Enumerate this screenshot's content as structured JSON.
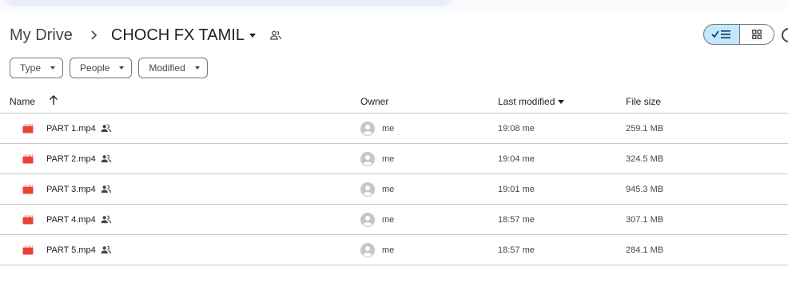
{
  "breadcrumb": {
    "root": "My Drive",
    "current": "CHOCH FX TAMIL"
  },
  "filters": [
    {
      "label": "Type"
    },
    {
      "label": "People"
    },
    {
      "label": "Modified"
    }
  ],
  "columns": {
    "name": "Name",
    "owner": "Owner",
    "last_modified": "Last modified",
    "file_size": "File size"
  },
  "files": [
    {
      "name": "PART 1.mp4",
      "owner": "me",
      "modified": "19:08 me",
      "size": "259.1 MB"
    },
    {
      "name": "PART 2.mp4",
      "owner": "me",
      "modified": "19:04 me",
      "size": "324.5 MB"
    },
    {
      "name": "PART 3.mp4",
      "owner": "me",
      "modified": "19:01 me",
      "size": "945.3 MB"
    },
    {
      "name": "PART 4.mp4",
      "owner": "me",
      "modified": "18:57 me",
      "size": "307.1 MB"
    },
    {
      "name": "PART 5.mp4",
      "owner": "me",
      "modified": "18:57 me",
      "size": "284.1 MB"
    }
  ],
  "colors": {
    "accent": "#c2e7ff",
    "video_icon": "#ea4335",
    "divider": "#c4c7c5"
  },
  "icons": {
    "video": "video-file-icon",
    "shared": "shared-people-icon",
    "avatar": "default-avatar-icon",
    "sort": "arrow-up-icon"
  }
}
